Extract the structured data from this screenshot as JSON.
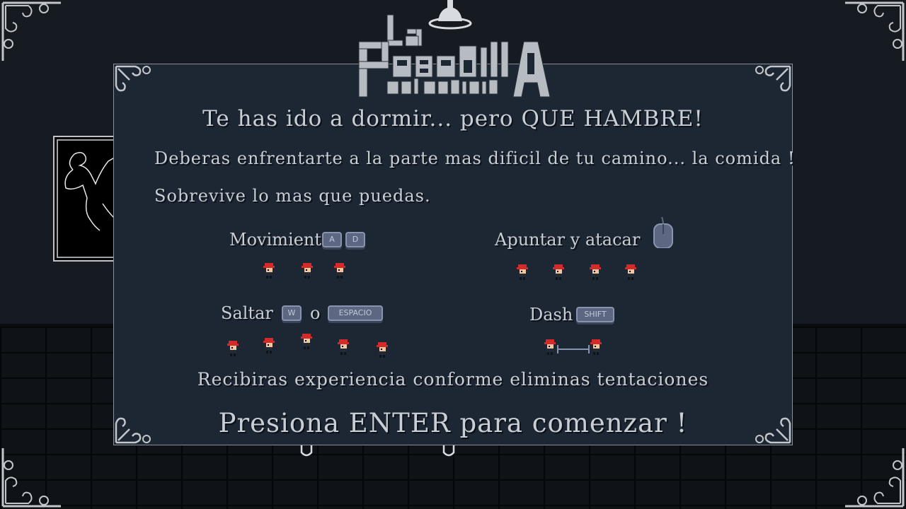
{
  "game": {
    "logo_text": "La Pesadilla del deficit",
    "headline": "Te has ido a dormir... pero QUE HAMBRE!",
    "line1": "Deberas enfrentarte a la parte mas dificil de tu camino... la comida !",
    "line2": "Sobrevive lo mas que puedas.",
    "controls": {
      "move_label": "Movimiento",
      "move_keys": [
        "A",
        "D"
      ],
      "aim_label": "Apuntar y atacar",
      "jump_label": "Saltar",
      "jump_key": "W",
      "jump_or": "o",
      "jump_alt_key": "ESPACIO",
      "dash_label": "Dash",
      "dash_key": "SHIFT"
    },
    "xp_text": "Recibiras experiencia conforme eliminas tentaciones",
    "start_prompt": "Presiona ENTER para comenzar !"
  },
  "colors": {
    "panel": "#1d2733",
    "text": "#c9cdd4",
    "key": "#5d6782",
    "sprite_hat": "#d42a2a"
  }
}
